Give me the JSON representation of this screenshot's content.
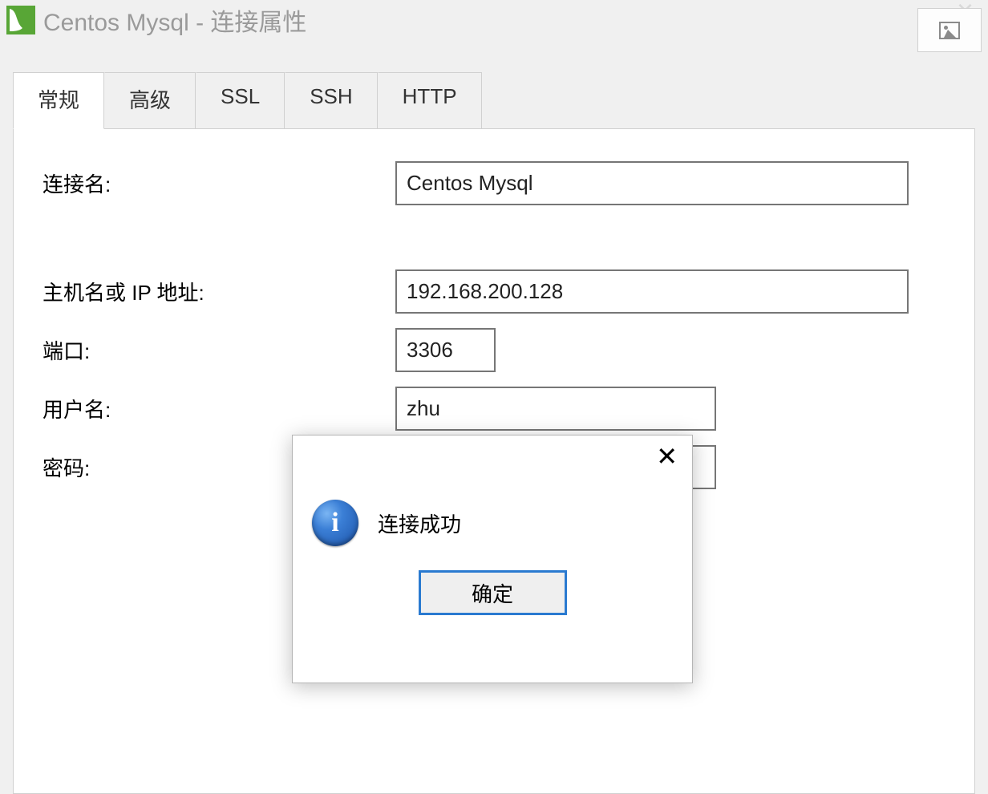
{
  "titlebar": {
    "app_name": "Centos Mysql",
    "suffix": " - 连接属性"
  },
  "tabs": [
    {
      "label": "常规",
      "active": true
    },
    {
      "label": "高级",
      "active": false
    },
    {
      "label": "SSL",
      "active": false
    },
    {
      "label": "SSH",
      "active": false
    },
    {
      "label": "HTTP",
      "active": false
    }
  ],
  "form": {
    "connection_name_label": "连接名:",
    "connection_name_value": "Centos Mysql",
    "host_label": "主机名或 IP 地址:",
    "host_value": "192.168.200.128",
    "port_label": "端口:",
    "port_value": "3306",
    "username_label": "用户名:",
    "username_value": "zhu",
    "password_label": "密码:",
    "password_value": "••••••"
  },
  "dialog": {
    "message": "连接成功",
    "ok_label": "确定"
  }
}
